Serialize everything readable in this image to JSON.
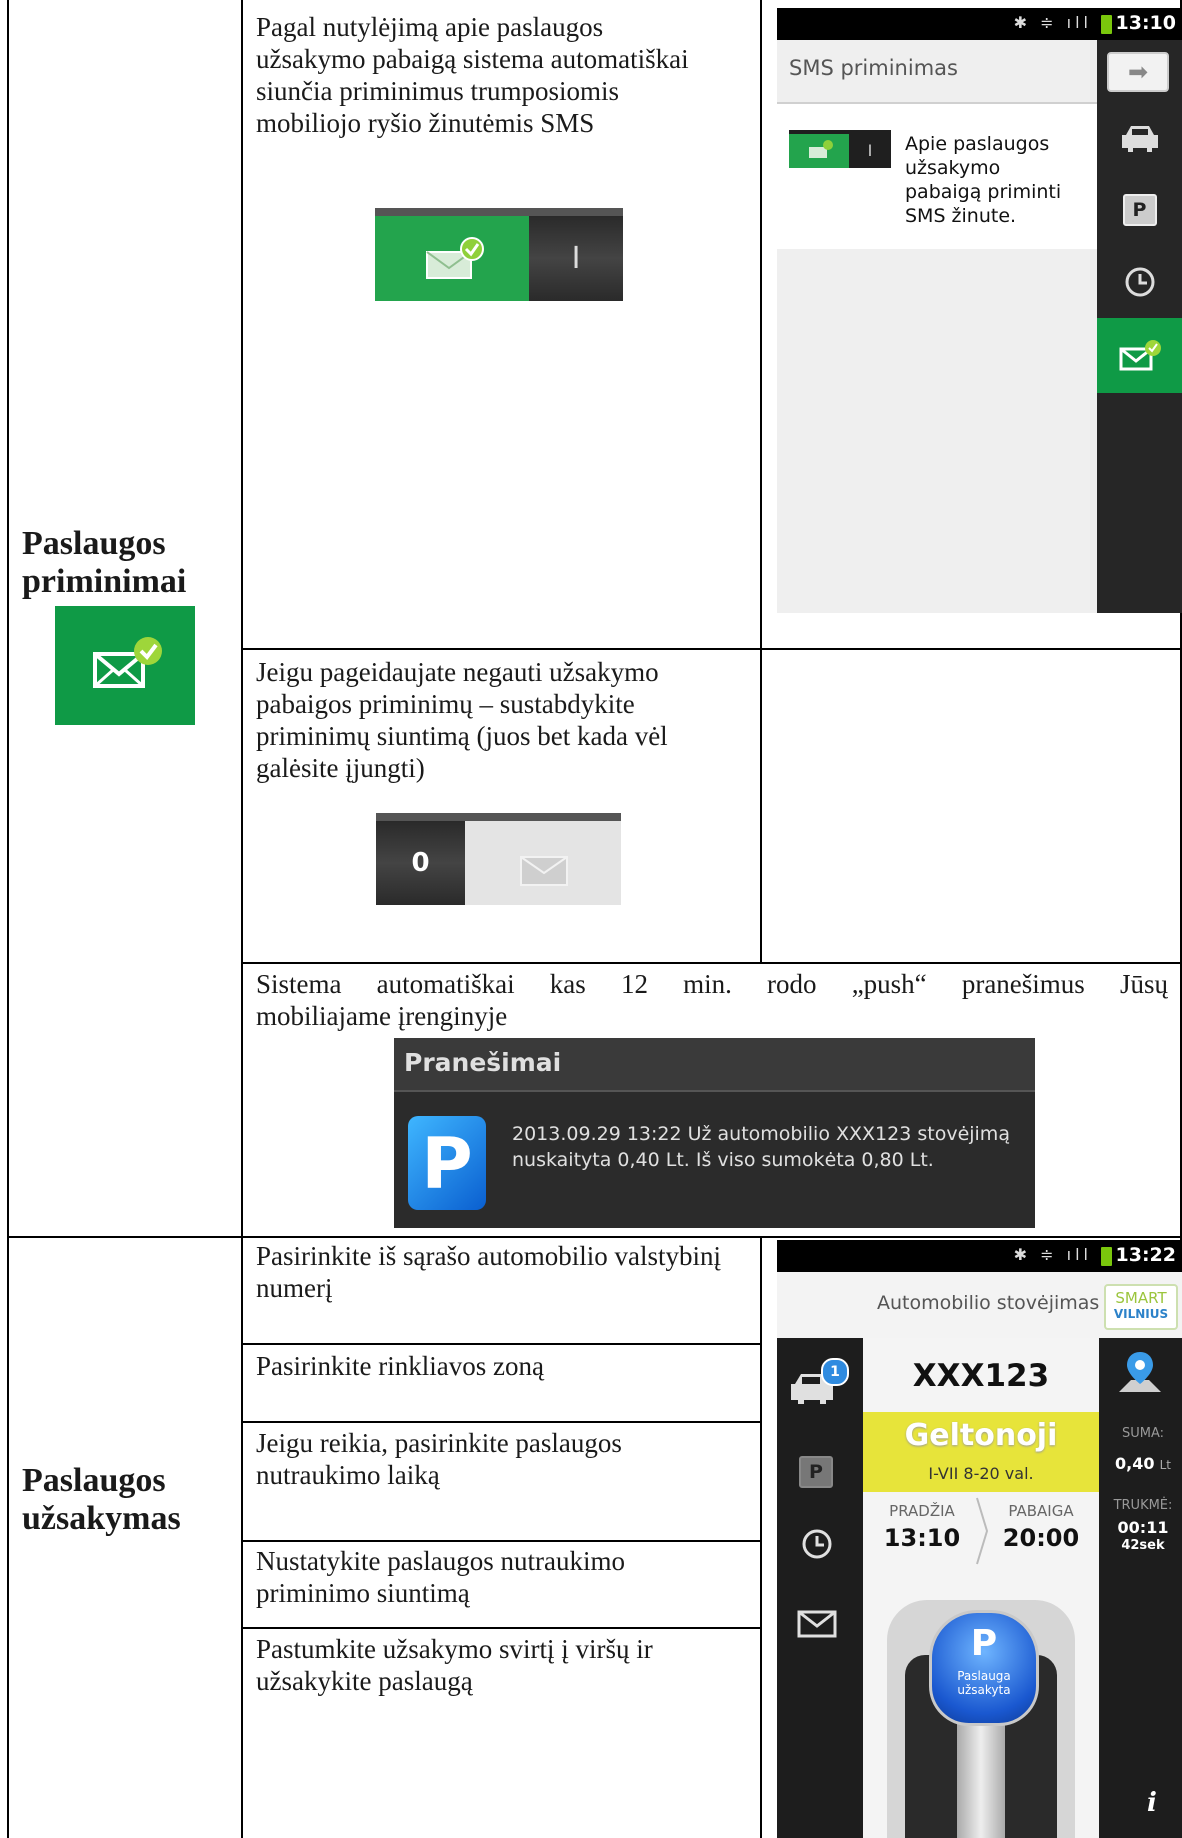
{
  "sections": {
    "reminders": {
      "title": "Paslaugos priminimai",
      "title_line1": "Paslaugos",
      "title_line2": "priminimai",
      "row1_text": "Pagal nutylėjimą apie paslaugos užsakymo pabaigą sistema automatiškai siunčia priminimus trumposiomis mobiliojo ryšio žinutėmis SMS",
      "row2_text": "Jeigu pageidaujate negauti užsakymo pabaigos priminimų – sustabdykite priminimų siuntimą (juos bet kada vėl galėsite įjungti)",
      "toggle_off_label": "0",
      "toggle_on_label": "I",
      "row3_text": "Sistema automatiškai kas 12 min. rodo „push“ pranešimus Jūsų mobiliajame įrenginyje"
    },
    "order": {
      "title_line1": "Paslaugos",
      "title_line2": "užsakymas",
      "steps": [
        "Pasirinkite iš sąrašo automobilio valstybinį numerį",
        "Pasirinkite rinkliavos zoną",
        "Jeigu reikia, pasirinkite paslaugos nutraukimo laiką",
        "Nustatykite paslaugos  nutraukimo priminimo siuntimą",
        "Pastumkite užsakymo svirtį į viršų ir užsakykite paslaugą"
      ]
    }
  },
  "sms_screen": {
    "time": "13:10",
    "title": "SMS priminimas",
    "description": "Apie paslaugos užsakymo pabaigą priminti SMS žinute.",
    "toggle_on_label": "I"
  },
  "notification": {
    "header": "Pranešimai",
    "icon_letter": "P",
    "text": "2013.09.29 13:22 Už automobilio XXX123 stovėjimą nuskaityta 0,40 Lt. Iš viso sumokėta 0,80 Lt."
  },
  "parking_screen": {
    "time": "13:22",
    "title": "Automobilio stovėjimas",
    "logo_line1": "SMART",
    "logo_line2": "VILNIUS",
    "car_badge": "1",
    "plate": "XXX123",
    "zone_name": "Geltonoji",
    "zone_hours": "I-VII 8-20 val.",
    "start_label": "PRADŽIA",
    "start_time": "13:10",
    "end_label": "PABAIGA",
    "end_time": "20:00",
    "sum_label": "SUMA:",
    "sum_value": "0,40",
    "sum_unit": "Lt",
    "duration_label": "TRUKMĖ:",
    "duration_value": "00:11",
    "duration_sec": "42sek",
    "lever_letter": "P",
    "lever_line1": "Paslauga",
    "lever_line2": "užsakyta",
    "info_label": "i"
  },
  "colors": {
    "green": "#0f9a46",
    "yellow": "#e7e43a",
    "blue": "#1a6fd8"
  }
}
